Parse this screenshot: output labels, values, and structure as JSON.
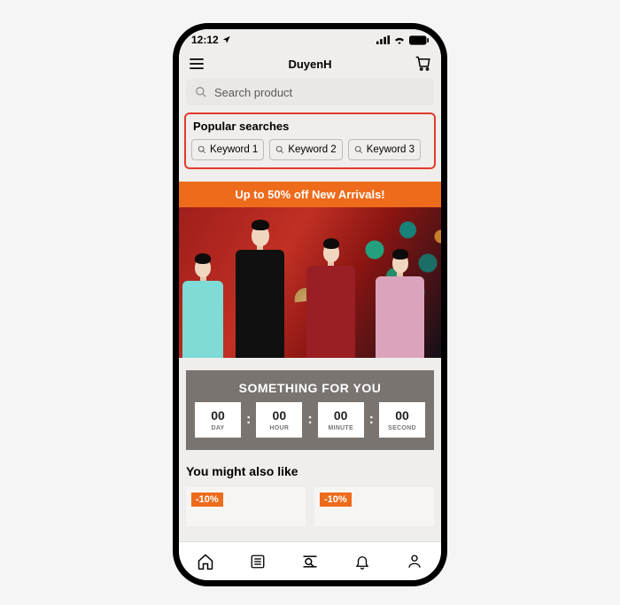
{
  "status": {
    "time": "12:12"
  },
  "header": {
    "title": "DuyenH"
  },
  "search": {
    "placeholder": "Search product"
  },
  "popular": {
    "title": "Popular searches",
    "keywords": [
      "Keyword 1",
      "Keyword 2",
      "Keyword 3"
    ]
  },
  "promo": {
    "text": "Up to 50% off New Arrivals!"
  },
  "countdown": {
    "title": "SOMETHING FOR YOU",
    "units": [
      {
        "value": "00",
        "label": "DAY"
      },
      {
        "value": "00",
        "label": "HOUR"
      },
      {
        "value": "00",
        "label": "MINUTE"
      },
      {
        "value": "00",
        "label": "SECOND"
      }
    ],
    "separator": ":"
  },
  "also": {
    "title": "You might also like",
    "items": [
      {
        "discount": "-10%"
      },
      {
        "discount": "-10%"
      }
    ]
  },
  "colors": {
    "accent": "#ee6b1b",
    "highlight": "#e23a2c"
  }
}
